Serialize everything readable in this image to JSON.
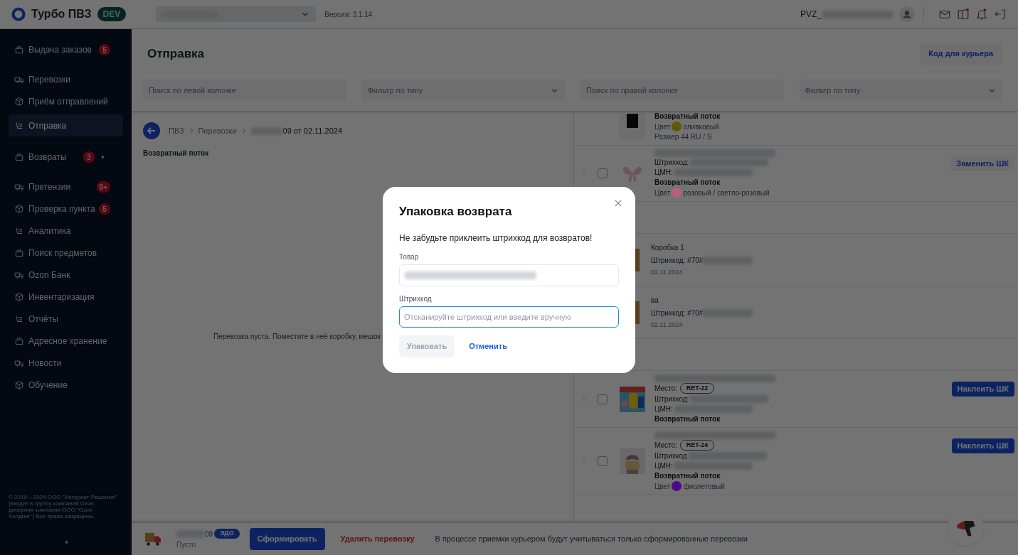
{
  "header": {
    "app_name": "Турбо ПВЗ",
    "env_badge": "DEV",
    "version": "Версия: 3.1.14",
    "user": "PVZ_"
  },
  "sidebar": {
    "groups": [
      [
        {
          "label": "Выдача заказов",
          "badge": "5",
          "selected": false
        }
      ],
      [
        {
          "label": "Перевозки",
          "selected": false
        },
        {
          "label": "Приём отправлений",
          "selected": false
        },
        {
          "label": "Отправка",
          "selected": true
        }
      ],
      [
        {
          "label": "Возвраты",
          "badge": "3",
          "submenu": true,
          "selected": false
        }
      ],
      [
        {
          "label": "Претензии",
          "badge": "9+",
          "selected": false
        },
        {
          "label": "Проверка пункта",
          "badge": "5",
          "selected": false
        },
        {
          "label": "Аналитика",
          "selected": false
        },
        {
          "label": "Поиск предметов",
          "selected": false
        },
        {
          "label": "Ozon Банк",
          "selected": false
        },
        {
          "label": "Инвентаризация",
          "selected": false
        },
        {
          "label": "Отчёты",
          "selected": false
        },
        {
          "label": "Адресное хранение",
          "selected": false
        },
        {
          "label": "Новости",
          "selected": false
        },
        {
          "label": "Обучение",
          "selected": false
        }
      ]
    ],
    "copyright": "© 2019 – 2024 ООО \"Интернет Решения\" (входит в группу компаний Ozon; дочерняя компания ООО \"Озон Холдинг\") Все права защищены."
  },
  "page": {
    "title": "Отправка",
    "courier_button": "Код для курьера",
    "filters": [
      {
        "kind": "search",
        "placeholder": "Поиск по левой колонке"
      },
      {
        "kind": "select",
        "placeholder": "Фильтр по типу"
      },
      {
        "kind": "search",
        "placeholder": "Поиск по правой колонке"
      },
      {
        "kind": "select",
        "placeholder": "Фильтр по типу"
      }
    ]
  },
  "left": {
    "breadcrumbs": [
      "ПВЗ",
      "Перевозки",
      "09 от 02.11.2024"
    ],
    "flow": "Возвратный поток",
    "empty_text": "Перевозка пуста. Поместите в неё коробку, мешок"
  },
  "right": {
    "groups": [
      [
        {
          "kind": "item",
          "lines": [
            {
              "kind": "bold",
              "text": "Возвратный поток"
            },
            {
              "kind": "color",
              "label": "Цвет",
              "value": "оливковый",
              "color": "#5c5a05"
            },
            {
              "kind": "plain",
              "text": "Размер 44 RU / S"
            }
          ]
        },
        {
          "kind": "item",
          "checked": false,
          "button": {
            "label": "Заменить ШК",
            "kind": "secondary"
          },
          "lines": [
            {
              "kind": "field",
              "text": "Штрихкод:"
            },
            {
              "kind": "field",
              "text": "ЦМН:"
            },
            {
              "kind": "bold",
              "text": "Возвратный поток"
            },
            {
              "kind": "color",
              "label": "Цвет",
              "value": "розовый / светло-розовый",
              "color": "#b8607a"
            }
          ]
        }
      ],
      [
        {
          "kind": "box",
          "title": "Коробка 1",
          "barcode": "Штрихкод: #70#",
          "date": "02.11.2024"
        },
        {
          "kind": "box",
          "title": "ва",
          "barcode": "Штрихкод: #70#",
          "date": "02.11.2024"
        }
      ],
      [
        {
          "kind": "item",
          "checked": false,
          "button": {
            "label": "Наклеить ШК",
            "kind": "primary"
          },
          "lines": [
            {
              "kind": "place",
              "label": "Место:",
              "value": "RET-22"
            },
            {
              "kind": "field",
              "text": "Штрихкод:"
            },
            {
              "kind": "field",
              "text": "ЦМН:"
            },
            {
              "kind": "bold",
              "text": "Возвратный поток"
            }
          ]
        },
        {
          "kind": "item",
          "checked": false,
          "button": {
            "label": "Наклеить ШК",
            "kind": "primary"
          },
          "lines": [
            {
              "kind": "place",
              "label": "Место:",
              "value": "RET-24"
            },
            {
              "kind": "field",
              "text": "Штрихкод"
            },
            {
              "kind": "field",
              "text": "ЦМН:"
            },
            {
              "kind": "bold",
              "text": "Возвратный поток"
            },
            {
              "kind": "color",
              "label": "Цвет",
              "value": "фиолетовый",
              "color": "#4b0a8a"
            }
          ]
        }
      ]
    ]
  },
  "bottom_bar": {
    "shipment": "09",
    "edo_badge": "ЭДО",
    "status": "Пусто",
    "form_button": "Сформировать",
    "delete_link": "Удалить перевозку",
    "note": "В процессе приемки курьером будут учитываться только сформированные перевозки"
  },
  "modal": {
    "title": "Упаковка возврата",
    "message": "Не забудьте приклеить штрихкод для возвратов!",
    "fields": [
      {
        "label": "Товар",
        "kind": "redacted"
      },
      {
        "label": "Штрихкод",
        "placeholder": "Отсканируйте штрихкод или введите вручную",
        "focused": true
      }
    ],
    "pack_button": {
      "label": "Упаковать",
      "disabled": true
    },
    "cancel_link": "Отменить"
  }
}
